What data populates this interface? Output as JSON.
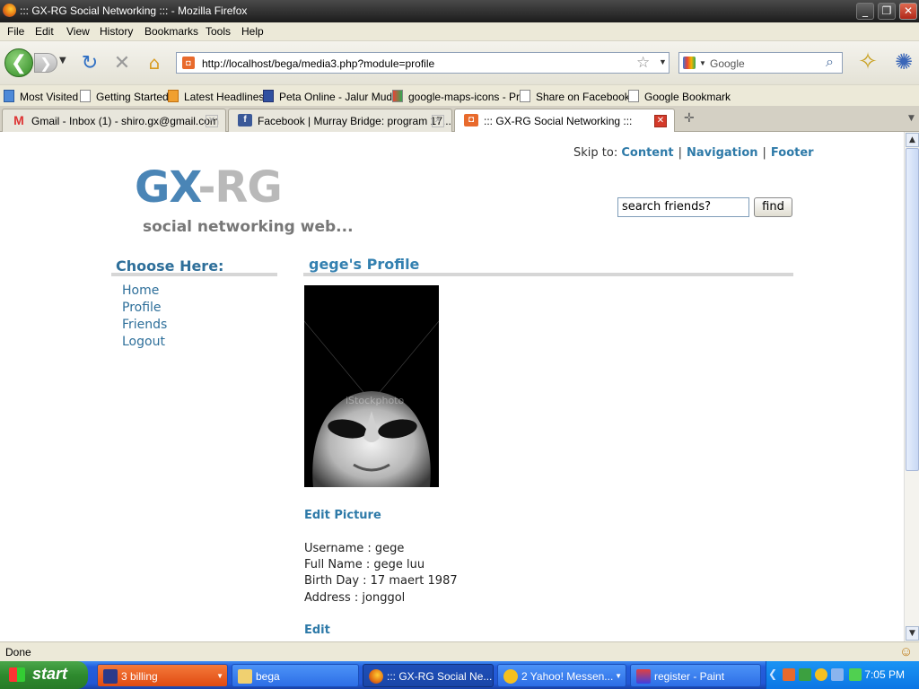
{
  "window": {
    "title": "::: GX-RG Social Networking ::: - Mozilla Firefox"
  },
  "menu": [
    "File",
    "Edit",
    "View",
    "History",
    "Bookmarks",
    "Tools",
    "Help"
  ],
  "address": {
    "url": "http://localhost/bega/media3.php?module=profile"
  },
  "search_engine": {
    "placeholder": "Google"
  },
  "bookmarks": [
    "Most Visited",
    "Getting Started",
    "Latest Headlines",
    "Peta Online - Jalur Mud...",
    "google-maps-icons - Pr...",
    "Share on Facebook",
    "Google Bookmark"
  ],
  "tabs": [
    {
      "label": "Gmail - Inbox (1) - shiro.gx@gmail.com"
    },
    {
      "label": "Facebook | Murray Bridge: program 17..."
    },
    {
      "label": "::: GX-RG Social Networking :::"
    }
  ],
  "page": {
    "logo_a": "GX",
    "logo_dash": "-",
    "logo_b": "RG",
    "tagline": "social networking web...",
    "skip_label": "Skip to:",
    "skip_links": [
      "Content",
      "Navigation",
      "Footer"
    ],
    "search_value": "search friends?",
    "find_label": "find",
    "sidebar_heading": "Choose Here:",
    "nav": [
      "Home",
      "Profile",
      "Friends",
      "Logout"
    ],
    "profile_heading": "gege's Profile",
    "photo_watermark": "iStockphoto",
    "edit_picture": "Edit Picture",
    "fields": [
      "Username : gege",
      "Full Name : gege luu",
      "Birth Day : 17 maert 1987",
      "Address : jonggol"
    ],
    "edit": "Edit"
  },
  "status": "Done",
  "taskbar": {
    "start": "start",
    "tasks": [
      "3 billing",
      "bega",
      "::: GX-RG Social Ne...",
      "2 Yahoo! Messen...",
      "register - Paint"
    ],
    "clock": "7:05 PM"
  }
}
